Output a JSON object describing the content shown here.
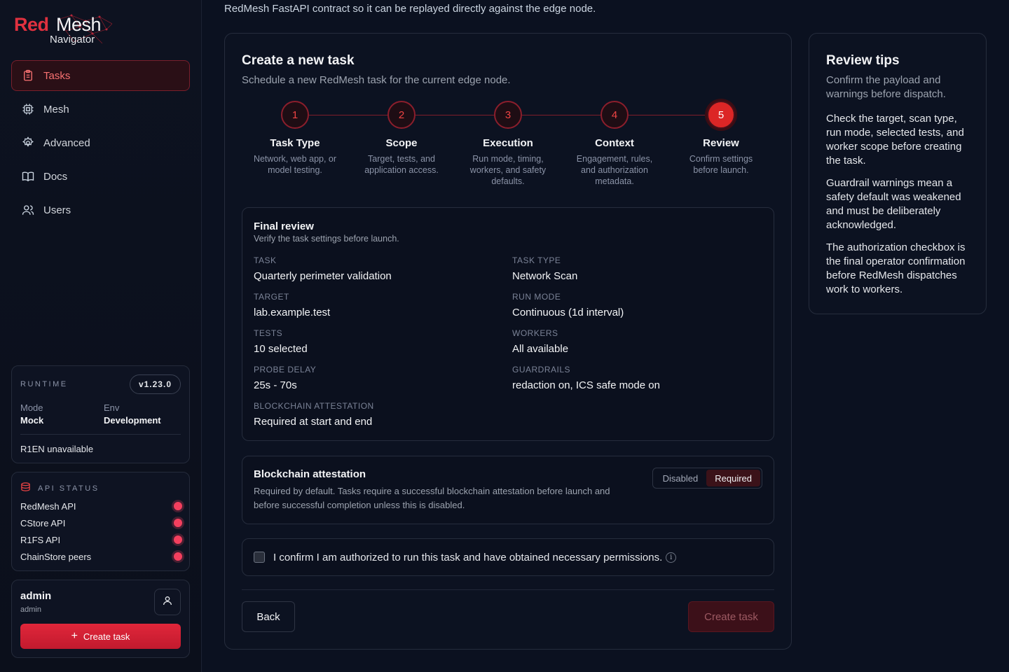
{
  "brand": {
    "red": "Red",
    "mesh": "Mesh",
    "sub": "Navigator",
    "accent": "#e0313f"
  },
  "nav": {
    "items": [
      {
        "label": "Tasks",
        "icon": "clipboard-icon",
        "active": true
      },
      {
        "label": "Mesh",
        "icon": "cpu-icon",
        "active": false
      },
      {
        "label": "Advanced",
        "icon": "gear-icon",
        "active": false
      },
      {
        "label": "Docs",
        "icon": "book-icon",
        "active": false
      },
      {
        "label": "Users",
        "icon": "users-icon",
        "active": false
      }
    ]
  },
  "runtime": {
    "label": "RUNTIME",
    "version": "v1.23.0",
    "mode_label": "Mode",
    "mode_value": "Mock",
    "env_label": "Env",
    "env_value": "Development",
    "note": "R1EN unavailable"
  },
  "api_status": {
    "label": "API STATUS",
    "items": [
      {
        "name": "RedMesh API",
        "status": "down"
      },
      {
        "name": "CStore API",
        "status": "down"
      },
      {
        "name": "R1FS API",
        "status": "down"
      },
      {
        "name": "ChainStore peers",
        "status": "down"
      }
    ]
  },
  "user": {
    "name": "admin",
    "role": "admin",
    "create_label": "Create task"
  },
  "intro": "RedMesh FastAPI contract so it can be replayed directly against the edge node.",
  "form": {
    "title": "Create a new task",
    "subtitle": "Schedule a new RedMesh task for the current edge node.",
    "steps": [
      {
        "num": "1",
        "title": "Task Type",
        "desc": "Network, web app, or model testing."
      },
      {
        "num": "2",
        "title": "Scope",
        "desc": "Target, tests, and application access."
      },
      {
        "num": "3",
        "title": "Execution",
        "desc": "Run mode, timing, workers, and safety defaults."
      },
      {
        "num": "4",
        "title": "Context",
        "desc": "Engagement, rules, and authorization metadata."
      },
      {
        "num": "5",
        "title": "Review",
        "desc": "Confirm settings before launch."
      }
    ],
    "current_step": 5,
    "review": {
      "title": "Final review",
      "subtitle": "Verify the task settings before launch.",
      "fields": {
        "task": {
          "label": "TASK",
          "value": "Quarterly perimeter validation"
        },
        "task_type": {
          "label": "TASK TYPE",
          "value": "Network Scan"
        },
        "target": {
          "label": "TARGET",
          "value": "lab.example.test"
        },
        "run_mode": {
          "label": "RUN MODE",
          "value": "Continuous (1d interval)"
        },
        "tests": {
          "label": "TESTS",
          "value": "10 selected"
        },
        "workers": {
          "label": "WORKERS",
          "value": "All available"
        },
        "probe_delay": {
          "label": "PROBE DELAY",
          "value": "25s - 70s"
        },
        "guardrails": {
          "label": "GUARDRAILS",
          "value": "redaction on, ICS safe mode on"
        },
        "blockchain": {
          "label": "BLOCKCHAIN ATTESTATION",
          "value": "Required at start and end"
        }
      }
    },
    "attestation": {
      "title": "Blockchain attestation",
      "desc": "Required by default. Tasks require a successful blockchain attestation before launch and before successful completion unless this is disabled.",
      "option_disabled": "Disabled",
      "option_required": "Required",
      "selected": "Required"
    },
    "confirm": {
      "text": "I confirm I am authorized to run this task and have obtained necessary permissions.",
      "checked": false,
      "info_glyph": "i"
    },
    "back_label": "Back",
    "create_label": "Create task"
  },
  "tips": {
    "title": "Review tips",
    "subtitle": "Confirm the payload and warnings before dispatch.",
    "items": [
      "Check the target, scan type, run mode, selected tests, and worker scope before creating the task.",
      "Guardrail warnings mean a safety default was weakened and must be deliberately acknowledged.",
      "The authorization checkbox is the final operator confirmation before RedMesh dispatches work to workers."
    ]
  }
}
